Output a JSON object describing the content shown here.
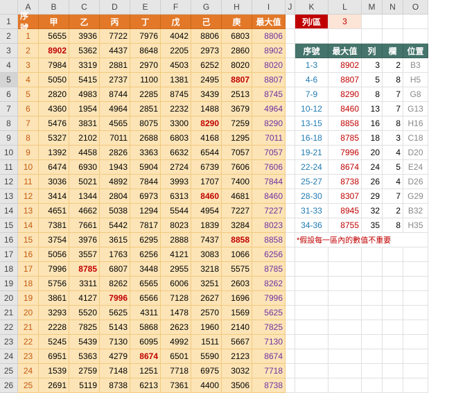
{
  "cols": [
    "",
    "A",
    "B",
    "C",
    "D",
    "E",
    "F",
    "G",
    "H",
    "I",
    "J",
    "K",
    "L",
    "M",
    "N",
    "O"
  ],
  "rowCount": 26,
  "headers": [
    "序號",
    "甲",
    "乙",
    "丙",
    "丁",
    "戊",
    "己",
    "庚",
    "最大值"
  ],
  "rows": [
    [
      1,
      5655,
      3936,
      7722,
      7976,
      4042,
      8806,
      6803,
      8806
    ],
    [
      2,
      8902,
      5362,
      4437,
      8648,
      2205,
      2973,
      2860,
      8902
    ],
    [
      3,
      7984,
      3319,
      2881,
      2970,
      4503,
      6252,
      8020,
      8020
    ],
    [
      4,
      5050,
      5415,
      2737,
      1100,
      1381,
      2495,
      8807,
      8807
    ],
    [
      5,
      2820,
      4983,
      8744,
      2285,
      8745,
      3439,
      2513,
      8745
    ],
    [
      6,
      4360,
      1954,
      4964,
      2851,
      2232,
      1488,
      3679,
      4964
    ],
    [
      7,
      5476,
      3831,
      4565,
      8075,
      3300,
      8290,
      7259,
      8290
    ],
    [
      8,
      5327,
      2102,
      7011,
      2688,
      6803,
      4168,
      1295,
      7011
    ],
    [
      9,
      1392,
      4458,
      2826,
      3363,
      6632,
      6544,
      7057,
      7057
    ],
    [
      10,
      6474,
      6930,
      1943,
      5904,
      2724,
      6739,
      7606,
      7606
    ],
    [
      11,
      3036,
      5021,
      4892,
      7844,
      3993,
      1707,
      7400,
      7844
    ],
    [
      12,
      3414,
      1344,
      2804,
      6973,
      6313,
      8460,
      4681,
      8460
    ],
    [
      13,
      4651,
      4662,
      5038,
      1294,
      5544,
      4954,
      7227,
      7227
    ],
    [
      14,
      7381,
      7661,
      5442,
      7817,
      8023,
      1839,
      3284,
      8023
    ],
    [
      15,
      3754,
      3976,
      3615,
      6295,
      2888,
      7437,
      8858,
      8858
    ],
    [
      16,
      5056,
      3557,
      1763,
      6256,
      4121,
      3083,
      1066,
      6256
    ],
    [
      17,
      7996,
      8785,
      6807,
      3448,
      2955,
      3218,
      5575,
      8785
    ],
    [
      18,
      5756,
      3311,
      8262,
      6565,
      6006,
      3251,
      2603,
      8262
    ],
    [
      19,
      3861,
      4127,
      7996,
      6566,
      7128,
      2627,
      1696,
      7996
    ],
    [
      20,
      3293,
      5520,
      5625,
      4311,
      1478,
      2570,
      1569,
      5625
    ],
    [
      21,
      2228,
      7825,
      5143,
      5868,
      2623,
      1960,
      2140,
      7825
    ],
    [
      22,
      5245,
      5439,
      7130,
      6095,
      4992,
      1511,
      5667,
      7130
    ],
    [
      23,
      6951,
      5363,
      4279,
      8674,
      6501,
      5590,
      2123,
      8674
    ],
    [
      24,
      1539,
      2759,
      7148,
      1251,
      7718,
      6975,
      3032,
      7718
    ],
    [
      25,
      2691,
      5119,
      8738,
      6213,
      7361,
      4400,
      3506,
      8738
    ]
  ],
  "redCells": {
    "2": 1,
    "4": 7,
    "7": 6,
    "12": 6,
    "15": 7,
    "17": 2,
    "19": 3,
    "23": 4
  },
  "k1": {
    "label": "列/區",
    "value": 3
  },
  "resultHeaders": [
    "序號",
    "最大值",
    "列",
    "欄",
    "位置"
  ],
  "results": [
    [
      "1-3",
      8902,
      3,
      2,
      "B3"
    ],
    [
      "4-6",
      8807,
      5,
      8,
      "H5"
    ],
    [
      "7-9",
      8290,
      8,
      7,
      "G8"
    ],
    [
      "10-12",
      8460,
      13,
      7,
      "G13"
    ],
    [
      "13-15",
      8858,
      16,
      8,
      "H16"
    ],
    [
      "16-18",
      8785,
      18,
      3,
      "C18"
    ],
    [
      "19-21",
      7996,
      20,
      4,
      "D20"
    ],
    [
      "22-24",
      8674,
      24,
      5,
      "E24"
    ],
    [
      "25-27",
      8738,
      26,
      4,
      "D26"
    ],
    [
      "28-30",
      8307,
      29,
      7,
      "G29"
    ],
    [
      "31-33",
      8945,
      32,
      2,
      "B32"
    ],
    [
      "34-36",
      8755,
      35,
      8,
      "H35"
    ]
  ],
  "note": "*假設每一區內的數值不重要",
  "chart_data": {
    "type": "table",
    "note": "spreadsheet data embedded above"
  }
}
